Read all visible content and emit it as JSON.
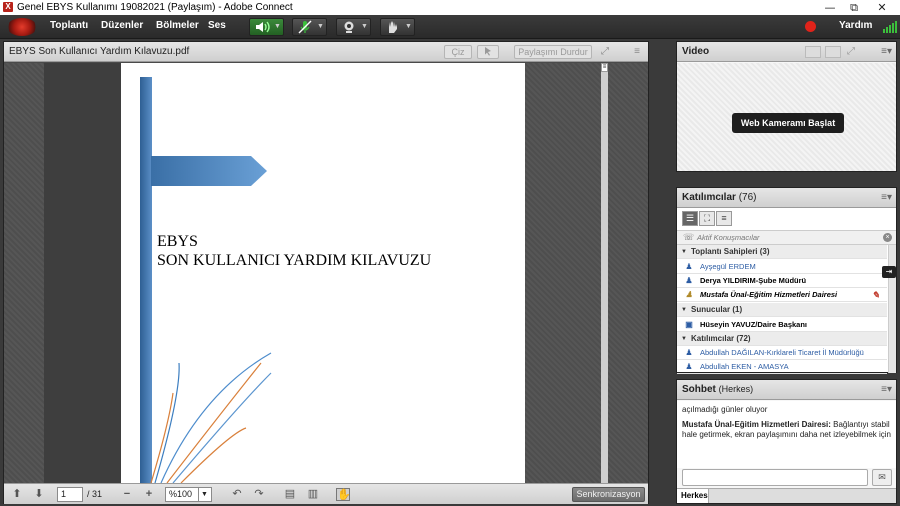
{
  "window": {
    "title": "Genel EBYS Kullanımı  19082021 (Paylaşım) - Adobe Connect",
    "app_icon_letter": "X",
    "minimize": "—",
    "restore": "⧉",
    "close": "✕"
  },
  "menu": {
    "items": [
      "Toplantı",
      "Düzenler",
      "Bölmeler",
      "Ses"
    ],
    "help": "Yardım",
    "toolbar_icons": [
      "speaker-icon",
      "microphone-icon",
      "webcam-icon",
      "raise-hand-icon"
    ]
  },
  "share": {
    "doc_title": "EBYS Son Kullanıcı Yardım Kılavuzu.pdf",
    "draw_label": "Çiz",
    "stop_sharing_label": "Paylaşımı Durdur",
    "page_line1": "EBYS",
    "page_line2": "SON KULLANICI YARDIM KILAVUZU",
    "current_page": "1",
    "total_pages": "/ 31",
    "zoom": "%100",
    "sync_label": "Senkronizasyon"
  },
  "video": {
    "title": "Video",
    "start_webcam_label": "Web Kameramı Başlat"
  },
  "participants": {
    "title": "Katılımcılar",
    "count": "(76)",
    "active_speakers_label": "Aktif Konuşmacılar",
    "groups": [
      {
        "label": "Toplantı Sahipleri (3)",
        "people": [
          "Ayşegül ERDEM",
          "Derya YILDIRIM-Şube Müdürü",
          "Mustafa Ünal-Eğitim Hizmetleri Dairesi"
        ]
      },
      {
        "label": "Sunucular (1)",
        "people": [
          "Hüseyin YAVUZ/Daire Başkanı"
        ]
      },
      {
        "label": "Katılımcılar (72)",
        "people": [
          "Abdullah DAĞILAN-Kırklareli Ticaret İl Müdürlüğü",
          "Abdullah EKEN - AMASYA"
        ]
      }
    ]
  },
  "chat": {
    "title": "Sohbet",
    "scope": "(Herkes)",
    "line1": "açılmadığı günler oluyor",
    "sender": "Mustafa Ünal-Eğitim Hizmetleri Dairesi:",
    "message": " Bağlantıyı stabil hale getirmek, ekran paylaşımını daha net izleyebilmek için",
    "tab_label": "Herkes"
  },
  "colors": {
    "accent_blue": "#2d5da4",
    "record_red": "#e0231a",
    "speaker_green": "#3cbf3c"
  }
}
